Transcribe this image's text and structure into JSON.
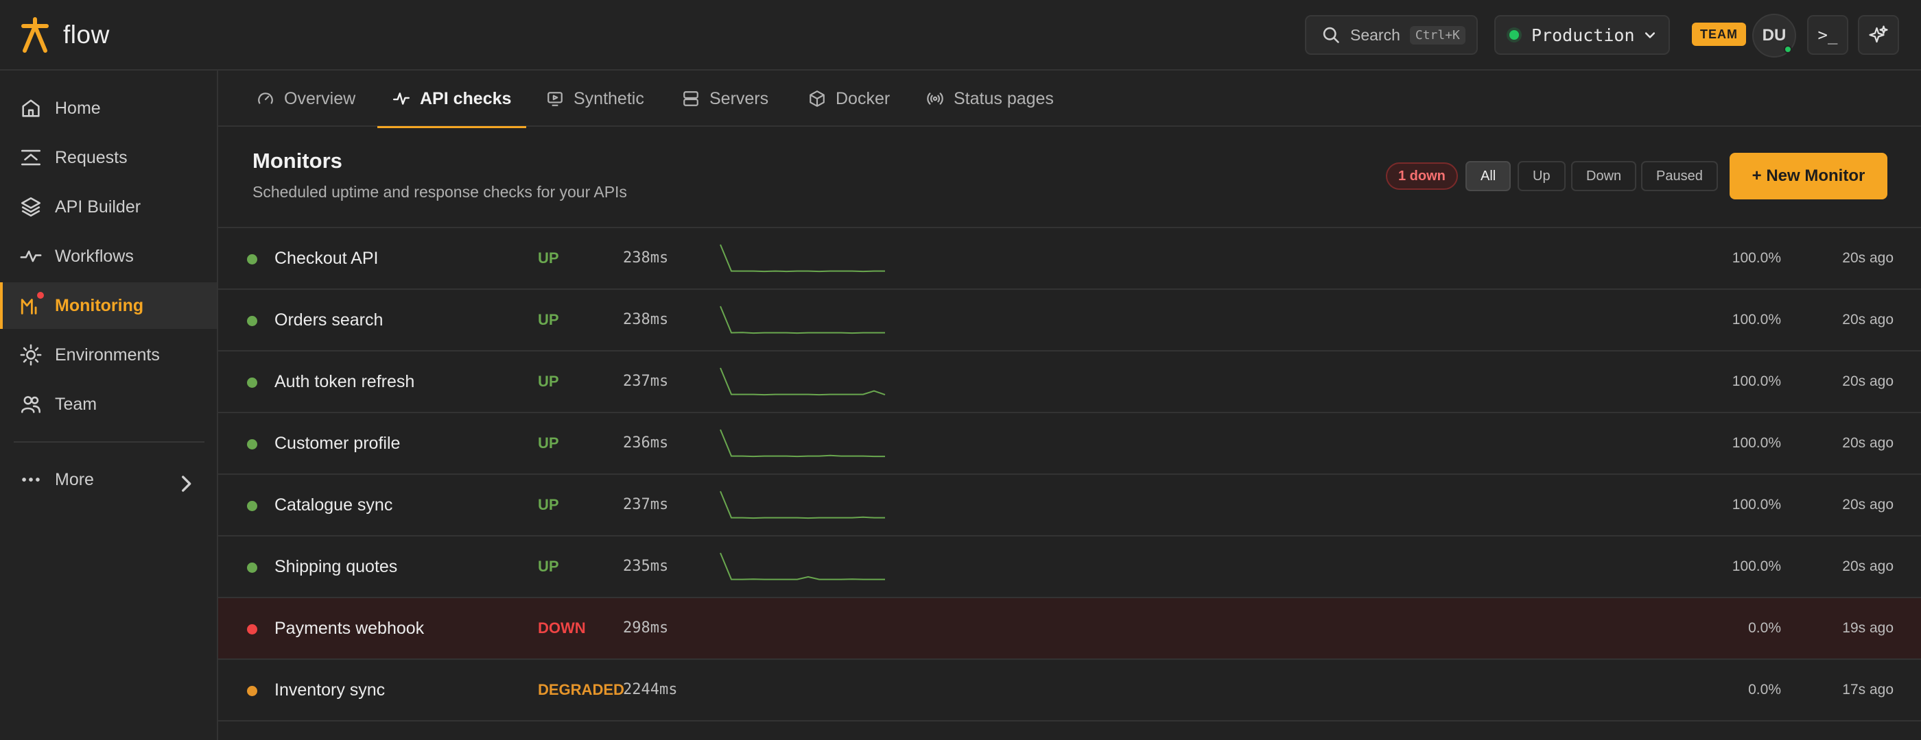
{
  "brand": {
    "name": "flow",
    "accent": "#f5a623"
  },
  "topbar": {
    "search_label": "Search",
    "search_shortcut": "Ctrl+K",
    "environment": "Production",
    "team_badge": "TEAM",
    "avatar_initials": "DU",
    "terminal_label": ">_"
  },
  "sidebar": {
    "items": [
      {
        "label": "Home",
        "icon": "home-icon"
      },
      {
        "label": "Requests",
        "icon": "requests-icon"
      },
      {
        "label": "API Builder",
        "icon": "layers-icon"
      },
      {
        "label": "Workflows",
        "icon": "workflow-icon"
      },
      {
        "label": "Monitoring",
        "icon": "monitoring-icon",
        "active": true
      },
      {
        "label": "Environments",
        "icon": "sun-icon"
      },
      {
        "label": "Team",
        "icon": "team-icon"
      }
    ],
    "more_label": "More"
  },
  "tabs": [
    {
      "label": "Overview",
      "icon": "gauge-icon"
    },
    {
      "label": "API checks",
      "icon": "pulse-icon",
      "active": true
    },
    {
      "label": "Synthetic",
      "icon": "monitor-play-icon"
    },
    {
      "label": "Servers",
      "icon": "server-icon"
    },
    {
      "label": "Docker",
      "icon": "box-icon"
    },
    {
      "label": "Status pages",
      "icon": "broadcast-icon"
    }
  ],
  "monitors_header": {
    "title": "Monitors",
    "subtitle": "Scheduled uptime and response checks for your APIs",
    "down_count_label": "1 down",
    "filters": [
      "All",
      "Up",
      "Down",
      "Paused"
    ],
    "active_filter": "All",
    "new_button_label": "+ New Monitor"
  },
  "status_colors": {
    "UP": "#6aa84f",
    "DOWN": "#ef4444",
    "DEGRADED": "#e6952a"
  },
  "monitors": [
    {
      "name": "Checkout API",
      "status": "UP",
      "latency": "238ms",
      "uptime": "100.0%",
      "last_check": "20s ago",
      "sparkline": [
        330,
        238,
        238,
        238,
        237,
        238,
        237,
        238,
        238,
        237,
        238,
        238,
        238,
        237,
        238,
        238
      ]
    },
    {
      "name": "Orders search",
      "status": "UP",
      "latency": "238ms",
      "uptime": "100.0%",
      "last_check": "20s ago",
      "sparkline": [
        330,
        238,
        239,
        237,
        238,
        238,
        238,
        237,
        238,
        238,
        238,
        238,
        237,
        238,
        238,
        238
      ]
    },
    {
      "name": "Auth token refresh",
      "status": "UP",
      "latency": "237ms",
      "uptime": "100.0%",
      "last_check": "20s ago",
      "sparkline": [
        330,
        238,
        238,
        238,
        237,
        238,
        238,
        238,
        238,
        237,
        238,
        238,
        238,
        238,
        250,
        237
      ]
    },
    {
      "name": "Customer profile",
      "status": "UP",
      "latency": "236ms",
      "uptime": "100.0%",
      "last_check": "20s ago",
      "sparkline": [
        330,
        238,
        238,
        237,
        238,
        238,
        238,
        237,
        238,
        238,
        240,
        238,
        238,
        238,
        237,
        237
      ]
    },
    {
      "name": "Catalogue sync",
      "status": "UP",
      "latency": "237ms",
      "uptime": "100.0%",
      "last_check": "20s ago",
      "sparkline": [
        330,
        238,
        238,
        237,
        238,
        238,
        238,
        238,
        237,
        238,
        238,
        238,
        238,
        240,
        238,
        238
      ]
    },
    {
      "name": "Shipping quotes",
      "status": "UP",
      "latency": "235ms",
      "uptime": "100.0%",
      "last_check": "20s ago",
      "sparkline": [
        330,
        238,
        238,
        239,
        238,
        238,
        238,
        238,
        247,
        238,
        238,
        238,
        239,
        238,
        238,
        238
      ]
    },
    {
      "name": "Payments webhook",
      "status": "DOWN",
      "latency": "298ms",
      "uptime": "0.0%",
      "last_check": "19s ago",
      "sparkline": []
    },
    {
      "name": "Inventory sync",
      "status": "DEGRADED",
      "latency": "2244ms",
      "uptime": "0.0%",
      "last_check": "17s ago",
      "sparkline": []
    }
  ]
}
